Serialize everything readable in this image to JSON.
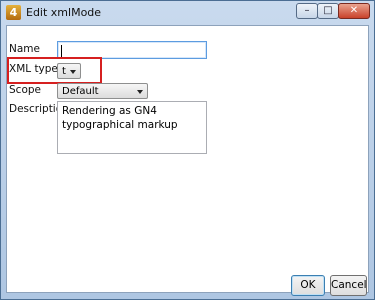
{
  "window": {
    "title": "Edit xmlMode",
    "app_icon_glyph": "4",
    "controls": {
      "minimize": "–",
      "maximize": "□",
      "close": "✕"
    }
  },
  "form": {
    "name_label": "Name",
    "name_value": "",
    "xml_type_label": "XML type",
    "xml_type_value": "t",
    "scope_label": "Scope",
    "scope_value": "Default",
    "description_label": "Description",
    "description_value": "Rendering as GN4 typographical markup"
  },
  "buttons": {
    "ok_label": "OK",
    "cancel_label": "Cancel"
  },
  "colors": {
    "highlight": "#d62020",
    "title_bar": "#c9daee"
  }
}
